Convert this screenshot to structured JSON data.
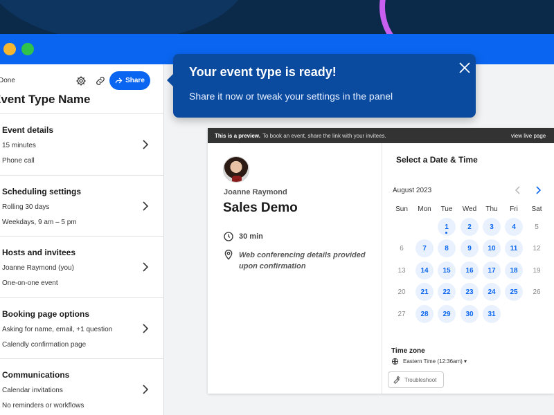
{
  "left_panel": {
    "done_label": "Done",
    "share_label": "Share",
    "event_type_title": "Event Type Name",
    "sections": [
      {
        "title": "Event details",
        "line1": "15 minutes",
        "line2": "Phone call"
      },
      {
        "title": "Scheduling settings",
        "line1": "Rolling 30 days",
        "line2": "Weekdays, 9 am – 5 pm"
      },
      {
        "title": "Hosts and invitees",
        "line1": "Joanne Raymond (you)",
        "line2": "One-on-one event"
      },
      {
        "title": "Booking page options",
        "line1": "Asking for name, email, +1 question",
        "line2": "Calendly confirmation page"
      },
      {
        "title": "Communications",
        "line1": "Calendar invitations",
        "line2": "No reminders or workflows"
      }
    ]
  },
  "toast": {
    "title": "Your event type is ready!",
    "text": "Share it now or tweak your settings in the panel"
  },
  "preview": {
    "bar_bold": "This is a preview.",
    "bar_text": "To book an event, share the link with your invitees.",
    "bar_live": "view live page",
    "host_name": "Joanne Raymond",
    "event_name": "Sales Demo",
    "duration": "30 min",
    "location": "Web conferencing details provided upon confirmation"
  },
  "calendar": {
    "title": "Select a Date & Time",
    "month": "August 2023",
    "weekdays": [
      "Sun",
      "Mon",
      "Tue",
      "Wed",
      "Thu",
      "Fri",
      "Sat"
    ],
    "weeks": [
      [
        null,
        null,
        {
          "d": "1",
          "a": true,
          "today": true
        },
        {
          "d": "2",
          "a": true
        },
        {
          "d": "3",
          "a": true
        },
        {
          "d": "4",
          "a": true
        },
        {
          "d": "5",
          "a": false
        }
      ],
      [
        {
          "d": "6",
          "a": false
        },
        {
          "d": "7",
          "a": true
        },
        {
          "d": "8",
          "a": true
        },
        {
          "d": "9",
          "a": true
        },
        {
          "d": "10",
          "a": true
        },
        {
          "d": "11",
          "a": true
        },
        {
          "d": "12",
          "a": false
        }
      ],
      [
        {
          "d": "13",
          "a": false
        },
        {
          "d": "14",
          "a": true
        },
        {
          "d": "15",
          "a": true
        },
        {
          "d": "16",
          "a": true
        },
        {
          "d": "17",
          "a": true
        },
        {
          "d": "18",
          "a": true
        },
        {
          "d": "19",
          "a": false
        }
      ],
      [
        {
          "d": "20",
          "a": false
        },
        {
          "d": "21",
          "a": true
        },
        {
          "d": "22",
          "a": true
        },
        {
          "d": "23",
          "a": true
        },
        {
          "d": "24",
          "a": true
        },
        {
          "d": "25",
          "a": true
        },
        {
          "d": "26",
          "a": false
        }
      ],
      [
        {
          "d": "27",
          "a": false
        },
        {
          "d": "28",
          "a": true
        },
        {
          "d": "29",
          "a": true
        },
        {
          "d": "30",
          "a": true
        },
        {
          "d": "31",
          "a": true
        },
        null,
        null
      ]
    ],
    "timezone_label": "Time zone",
    "timezone_value": "Eastern Time (12:36am) ▾",
    "troubleshoot_label": "Troubleshoot"
  },
  "colors": {
    "brand_blue": "#0a66f0",
    "toast_blue": "#0a4ba0",
    "available_day_bg": "#e8f1fd"
  }
}
